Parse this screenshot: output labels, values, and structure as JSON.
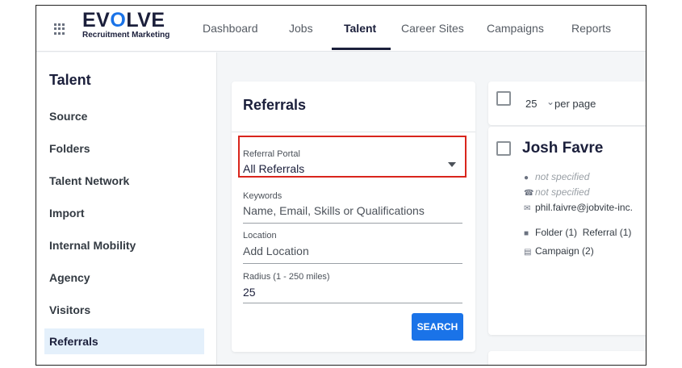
{
  "brand": {
    "name_prefix": "EV",
    "name_o": "O",
    "name_suffix": "LVE",
    "tagline": "Recruitment Marketing",
    "accent": "#1a73e8"
  },
  "nav": {
    "items": [
      {
        "label": "Dashboard"
      },
      {
        "label": "Jobs"
      },
      {
        "label": "Talent",
        "active": true
      },
      {
        "label": "Career Sites"
      },
      {
        "label": "Campaigns"
      },
      {
        "label": "Reports"
      }
    ]
  },
  "sidebar": {
    "title": "Talent",
    "items": [
      {
        "label": "Source"
      },
      {
        "label": "Folders"
      },
      {
        "label": "Talent Network"
      },
      {
        "label": "Import"
      },
      {
        "label": "Internal Mobility"
      },
      {
        "label": "Agency"
      },
      {
        "label": "Visitors"
      },
      {
        "label": "Referrals",
        "active": true
      }
    ]
  },
  "referrals": {
    "title": "Referrals",
    "portal": {
      "label": "Referral Portal",
      "value": "All Referrals"
    },
    "keywords": {
      "label": "Keywords",
      "placeholder": "Name, Email, Skills or Qualifications"
    },
    "location": {
      "label": "Location",
      "placeholder": "Add Location"
    },
    "radius": {
      "label": "Radius (1 - 250 miles)",
      "value": "25"
    },
    "search_label": "SEARCH",
    "highlight_color": "#d9251c"
  },
  "results": {
    "per_page_value": "25",
    "per_page_label": "per page",
    "candidate": {
      "name": "Josh Favre",
      "location": "not specified",
      "phone": "not specified",
      "email": "phil.faivre@jobvite-inc.",
      "folder_text": "Folder (1)",
      "referral_text": "Referral (1)",
      "campaign_text": "Campaign (2)"
    }
  }
}
